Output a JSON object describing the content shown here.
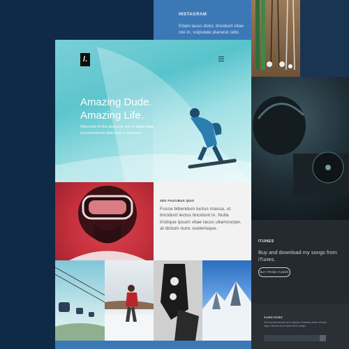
{
  "instagram": {
    "title": "INSTAGRAM",
    "text": "Etiam lacus dolor, tincidunt vitae nisi in, vulputate placerat odio."
  },
  "hero": {
    "logo": "/.",
    "headline_1": "Amazing Dude.",
    "headline_2": "Amazing Life.",
    "intro_prefix": "Welcome to the personal site of",
    "intro_name": "John Doe",
    "intro_line2": "A professional skier and a musician."
  },
  "feature": {
    "title": "SED FAUCIBUS QUIS",
    "text": "Fusce bibendum luctus massa, ut tincidunt lectus tincidunt in. Nulla tristique ipsum vitae lacus ullamcorper, at dictum nunc scelerisque."
  },
  "itunes": {
    "title": "ITUNES",
    "text": "Buy and download my songs from iTunes.",
    "button": "BUY FROM ITUNES"
  },
  "subscribe": {
    "title": "SUBSCRIBE",
    "text": "Duis tincidunt facilisis nisi in aliquam. Phasellus ornare vehicula augue. Aenean sed ut quam lorem congue."
  },
  "colors": {
    "accent_blue": "#3c78b6",
    "navy": "#0f2a46",
    "cyan_hero": "#58c3cc",
    "red_tile": "#c32f3b"
  }
}
